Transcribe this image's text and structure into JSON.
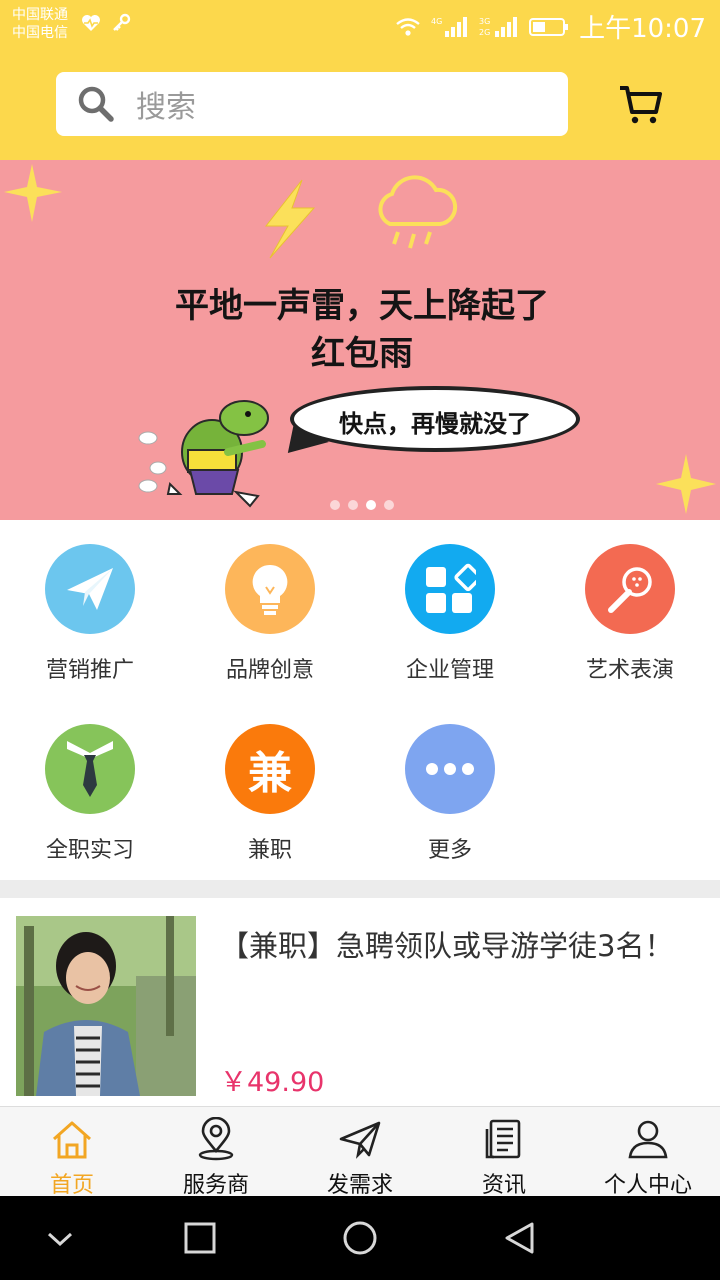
{
  "status_bar": {
    "carrier_1": "中国联通",
    "carrier_2": "中国电信",
    "time": "上午10:07"
  },
  "header": {
    "search_placeholder": "搜索"
  },
  "banner": {
    "headline_line1": "平地一声雷，天上降起了",
    "headline_line2": "红包雨",
    "bubble_text": "快点，再慢就没了",
    "page_count": 4,
    "active_page": 3
  },
  "categories": [
    {
      "label": "营销推广",
      "color": "#6cc6ee",
      "icon": "paper-plane-icon"
    },
    {
      "label": "品牌创意",
      "color": "#fdb65a",
      "icon": "lightbulb-icon"
    },
    {
      "label": "企业管理",
      "color": "#12aaf0",
      "icon": "grid-blocks-icon"
    },
    {
      "label": "艺术表演",
      "color": "#f36a52",
      "icon": "microphone-icon"
    },
    {
      "label": "全职实习",
      "color": "#86c45a",
      "icon": "necktie-icon"
    },
    {
      "label": "兼职",
      "color": "#fa7a0c",
      "icon": "jian-character-icon"
    },
    {
      "label": "更多",
      "color": "#7ea5f0",
      "icon": "more-dots-icon"
    }
  ],
  "product": {
    "title": "【兼职】急聘领队或导游学徒3名！",
    "price": "￥49.90"
  },
  "tabs": [
    {
      "label": "首页",
      "icon": "home-icon",
      "active": true
    },
    {
      "label": "服务商",
      "icon": "location-pin-icon",
      "active": false
    },
    {
      "label": "发需求",
      "icon": "send-plane-icon",
      "active": false
    },
    {
      "label": "资讯",
      "icon": "news-document-icon",
      "active": false
    },
    {
      "label": "个人中心",
      "icon": "user-icon",
      "active": false
    }
  ],
  "colors": {
    "brand_yellow": "#fcd84c",
    "price_pink": "#e8346b",
    "active_tab": "#f2a623"
  }
}
